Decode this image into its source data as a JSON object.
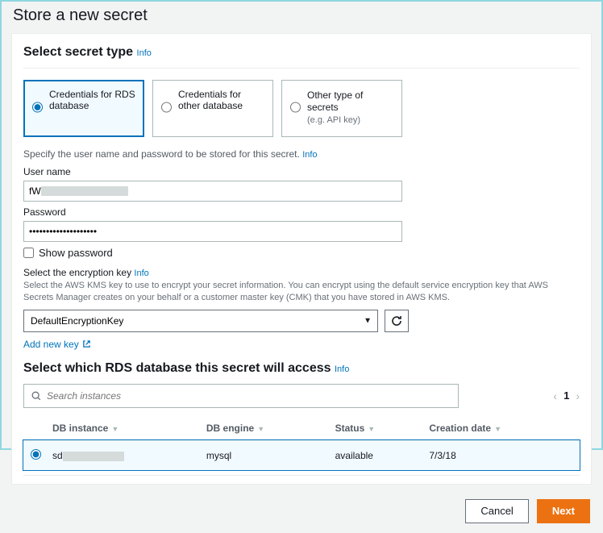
{
  "page": {
    "title": "Store a new secret"
  },
  "info_label": "Info",
  "secret_type": {
    "heading": "Select secret type",
    "options": [
      {
        "label": "Credentials for RDS database",
        "sub": ""
      },
      {
        "label": "Credentials for other database",
        "sub": ""
      },
      {
        "label": "Other type of secrets",
        "sub": "(e.g. API key)"
      }
    ],
    "selected_index": 0
  },
  "credentials": {
    "helper": "Specify the user name and password to be stored for this secret.",
    "username_label": "User name",
    "username_value": "fW",
    "password_label": "Password",
    "password_value": "••••••••••••••••••••",
    "show_password_label": "Show password",
    "show_password_checked": false
  },
  "encryption": {
    "heading": "Select the encryption key",
    "help": "Select the AWS KMS key to use to encrypt your secret information. You can encrypt using the default service encryption key that AWS Secrets Manager creates on your behalf or a customer master key (CMK) that you have stored in AWS KMS.",
    "selected": "DefaultEncryptionKey",
    "add_new_label": "Add new key"
  },
  "rds": {
    "heading": "Select which RDS database this secret will access",
    "search_placeholder": "Search instances",
    "page": "1",
    "columns": {
      "instance": "DB instance",
      "engine": "DB engine",
      "status": "Status",
      "created": "Creation date"
    },
    "rows": [
      {
        "selected": true,
        "instance_prefix": "sd",
        "engine": "mysql",
        "status": "available",
        "created": "7/3/18"
      }
    ]
  },
  "footer": {
    "cancel": "Cancel",
    "next": "Next"
  }
}
